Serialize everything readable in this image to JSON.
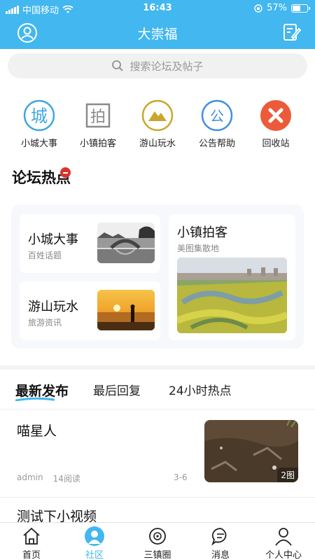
{
  "status": {
    "carrier": "中国移动",
    "time": "16:43",
    "battery": "57%",
    "battery_level": 0.57
  },
  "nav": {
    "title": "大崇福"
  },
  "search": {
    "placeholder": "搜索论坛及帖子"
  },
  "categories": [
    {
      "label": "小城大事",
      "glyph": "城",
      "icon": "city-icon",
      "color": "#3fa6e0"
    },
    {
      "label": "小镇拍客",
      "glyph": "拍",
      "icon": "camera-icon",
      "color": "#8a8a8a"
    },
    {
      "label": "游山玩水",
      "glyph": "",
      "icon": "mountain-icon",
      "color": "#c9a72c"
    },
    {
      "label": "公告帮助",
      "glyph": "公",
      "icon": "notice-icon",
      "color": "#3f8fe0"
    },
    {
      "label": "回收站",
      "glyph": "",
      "icon": "recycle-icon",
      "color": "#ec5a3a"
    }
  ],
  "hot": {
    "title": "论坛热点",
    "cards": [
      {
        "title": "小城大事",
        "subtitle": "百姓话题"
      },
      {
        "title": "游山玩水",
        "subtitle": "旅游资讯"
      },
      {
        "title": "小镇拍客",
        "subtitle": "美图集散地"
      }
    ]
  },
  "tabs": [
    "最新发布",
    "最后回复",
    "24小时热点"
  ],
  "posts": [
    {
      "title": "喵星人",
      "author": "admin",
      "views": "14阅读",
      "date": "3-6",
      "badge": "2图"
    },
    {
      "title": "测试下小视频"
    }
  ],
  "tabbar": [
    {
      "label": "首页",
      "icon": "home-icon"
    },
    {
      "label": "社区",
      "icon": "community-icon",
      "active": true
    },
    {
      "label": "三镇圈",
      "icon": "circle-icon"
    },
    {
      "label": "消息",
      "icon": "message-icon"
    },
    {
      "label": "个人中心",
      "icon": "user-icon"
    }
  ],
  "colors": {
    "primary": "#42b7f0",
    "hot_badge": "#d9342b"
  }
}
